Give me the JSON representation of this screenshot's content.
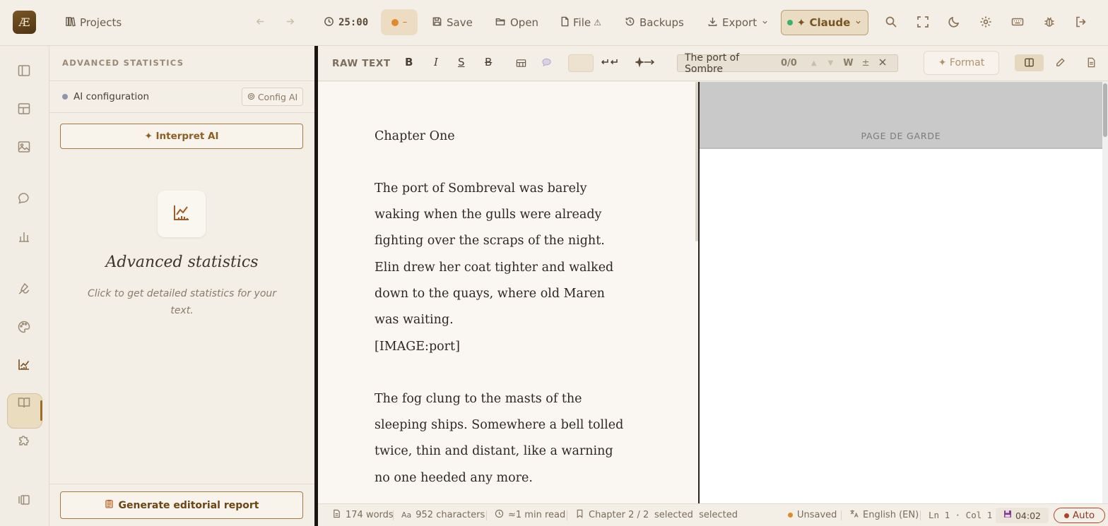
{
  "topbar": {
    "logo": "Æ",
    "projects_label": "Projects",
    "timer": "25:00",
    "session_label": "–",
    "save_label": "Save",
    "open_label": "Open",
    "file_label": "File",
    "file_warning": "⚠",
    "backups_label": "Backups",
    "export_label": "Export",
    "ai_model_label": "✦ Claude"
  },
  "panel": {
    "title": "ADVANCED STATISTICS",
    "ai_config_label": "AI configuration",
    "config_button": "Config AI",
    "interpret_button": "✦ Interpret AI",
    "heading": "Advanced statistics",
    "subtitle": "Click to get detailed statistics for your text.",
    "report_button": "Generate editorial report"
  },
  "editor_toolbar": {
    "mode_label": "RAW TEXT",
    "bold": "B",
    "italic": "I",
    "underline": "S",
    "strike": "B",
    "search_value": "The port of Sombre",
    "search_count": "0/0",
    "whole_word": "W",
    "case_toggle": "±",
    "format_button": "✦ Format"
  },
  "editor": {
    "paragraphs": [
      "Chapter One",
      "The port of Sombreval was barely waking when the gulls were already fighting over the scraps of the night. Elin drew her coat tighter and walked down to the quays, where old Maren was waiting.",
      "[IMAGE:port]",
      "The fog clung to the masts of the sleeping ships. Somewhere a bell tolled twice, thin and distant, like a warning no one heeded any more."
    ]
  },
  "preview": {
    "header": "PAGE DE GARDE"
  },
  "status": {
    "words": "174 words",
    "characters": "952 characters",
    "read_time": "≈1 min read",
    "chapter": "Chapter 2 / 2",
    "selection": "selected  selected",
    "save_state": "Unsaved",
    "language": "English (EN)",
    "cursor": "Ln 1 · Col 1",
    "time": "04:02",
    "auto_label": "Auto"
  },
  "colors": {
    "accent": "#9c6d2a",
    "unsaved_dot": "#e0892e",
    "ai_dot": "#39b36b",
    "auto_border": "#b0442a"
  }
}
